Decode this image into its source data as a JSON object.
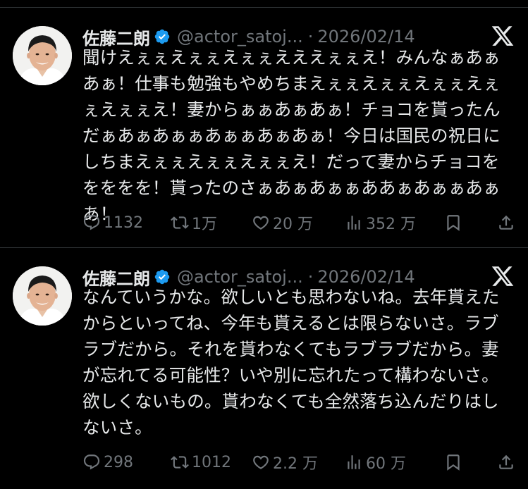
{
  "colors": {
    "background": "#000000",
    "text_primary": "#e7e9ea",
    "text_secondary": "#71767b",
    "verified_badge": "#1d9bf0",
    "divider": "#2f3336"
  },
  "tweets": [
    {
      "author": {
        "name": "佐藤二朗",
        "handle": "@actor_satoj...",
        "verified_icon": "verified-badge-icon"
      },
      "separator": "·",
      "date": "2026/02/14",
      "text": "聞けえぇぇえぇぇえぇぇえええぇぇえ！みんなぁあぁあぁ！仕事も勉強もやめちまえぇぇえぇぇえぇぇえぇぇえぇぇえ！妻からぁぁあぁあぁ！チョコを貰ったんだぁあぁあぁぁあぁぁあぁあぁ！今日は国民の祝日にしちまえぇぇえぇぇえぇぇえ！だって妻からチョコををををを！貰ったのさぁあぁあぁぁああぁあぁぁあぁあ！",
      "actions": {
        "replies": "1132",
        "retweets": "1万",
        "likes": "20 万",
        "views": "352 万"
      }
    },
    {
      "author": {
        "name": "佐藤二朗",
        "handle": "@actor_satoj...",
        "verified_icon": "verified-badge-icon"
      },
      "separator": "·",
      "date": "2026/02/14",
      "text": "なんていうかな。欲しいとも思わないね。去年貰えたからといってね、今年も貰えるとは限らないさ。ラブラブだから。それを貰わなくてもラブラブだから。妻が忘れてる可能性？いや別に忘れたって構わないさ。欲しくないもの。貰わなくても全然落ち込んだりはしないさ。",
      "actions": {
        "replies": "298",
        "retweets": "1012",
        "likes": "2.2 万",
        "views": "60 万"
      }
    }
  ]
}
